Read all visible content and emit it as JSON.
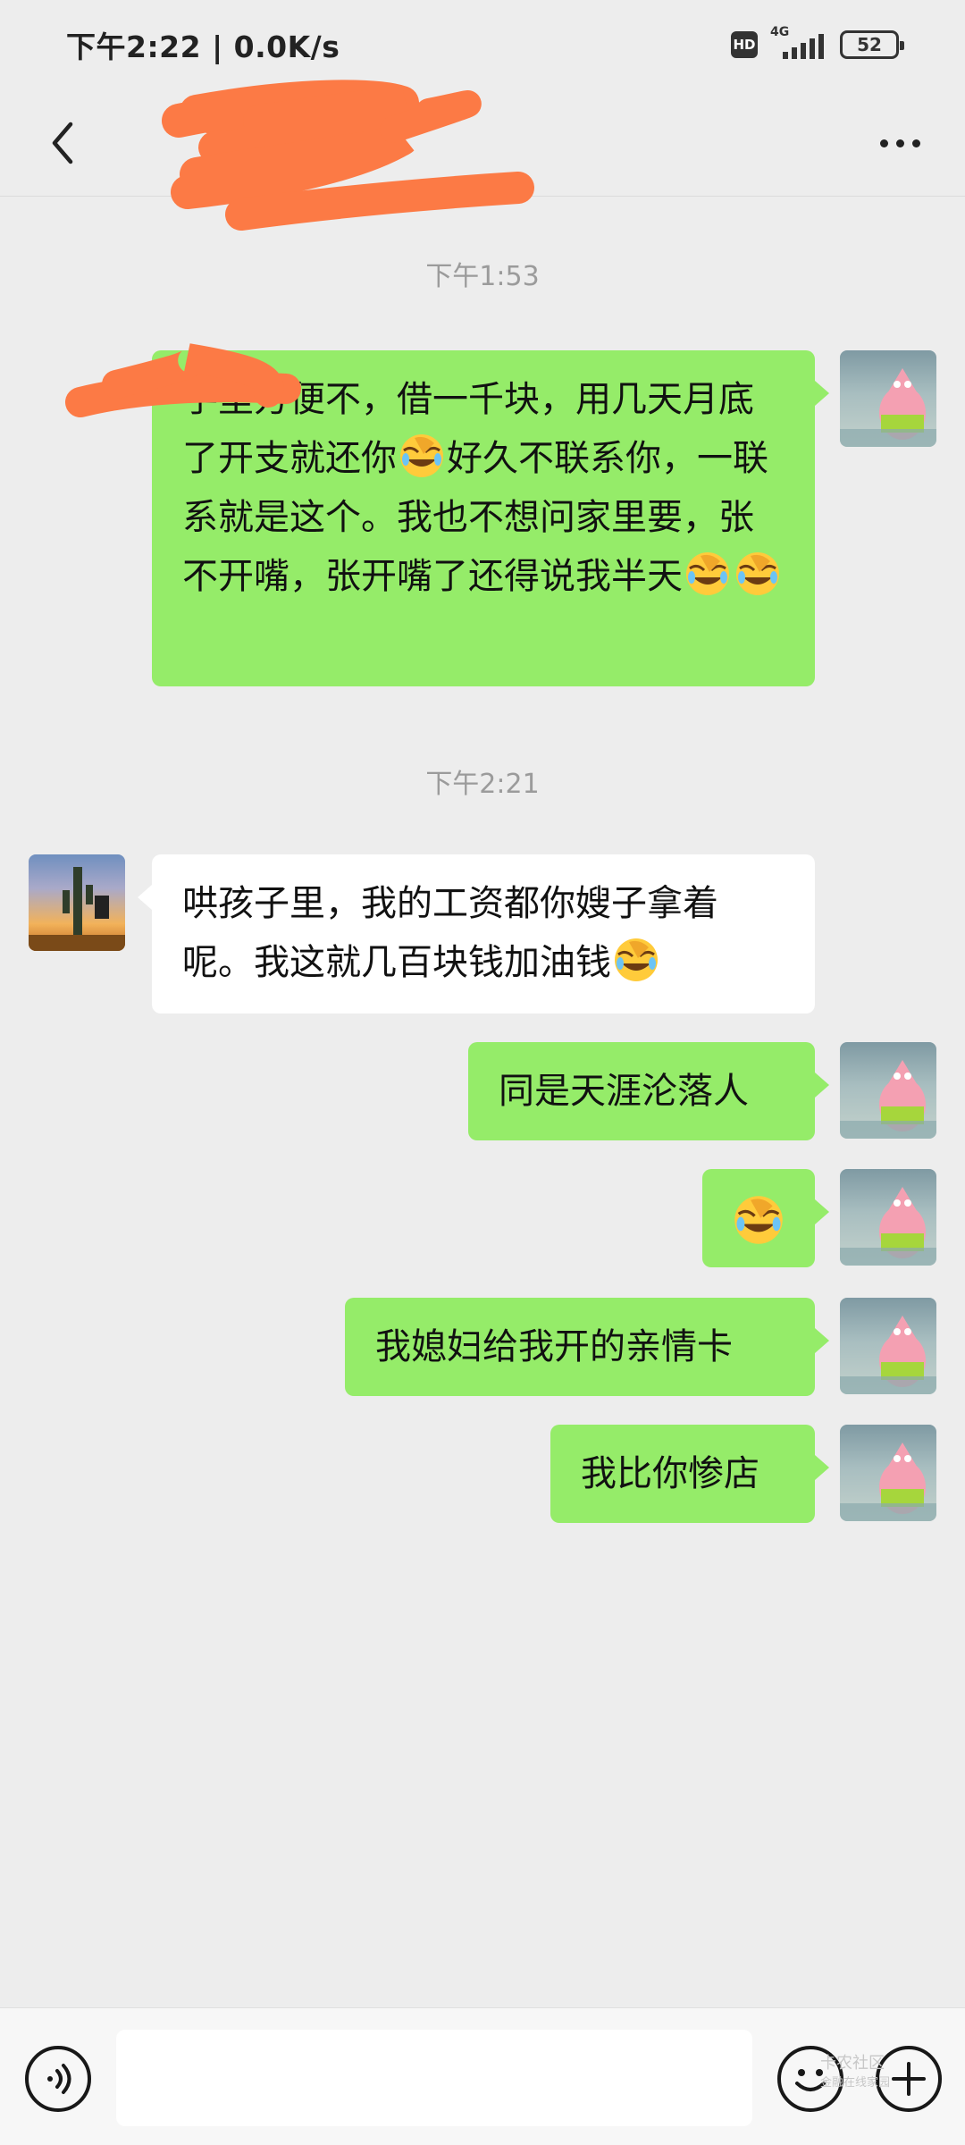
{
  "status_bar": {
    "time_speed": "下午2:22 | 0.0K/s",
    "hd": "HD",
    "network": "4G",
    "battery": "52"
  },
  "header": {
    "title": ""
  },
  "timestamps": [
    "下午1:53",
    "下午2:21"
  ],
  "messages": [
    {
      "side": "right",
      "segments": [
        "手里方便不，借一千块，用几天月底了开支就还你",
        "[emoji]",
        "好久不联系你，一联系就是这个。我也不想问家里要，张不开嘴，张开嘴了还得说我半天",
        "[emoji]",
        "[emoji]"
      ],
      "emoji": "facepalm-laugh-emoji"
    },
    {
      "side": "left",
      "text": "哄孩子里，我的工资都你嫂子拿着呢。我这就几百块钱加油钱",
      "emoji": "facepalm-laugh-emoji"
    },
    {
      "side": "right",
      "text": "同是天涯沦落人"
    },
    {
      "side": "right",
      "text": "",
      "emoji": "facepalm-laugh-emoji"
    },
    {
      "side": "right",
      "text": "我媳妇给我开的亲情卡"
    },
    {
      "side": "right",
      "text": "我比你惨店"
    }
  ],
  "input_bar": {
    "value": "",
    "watermark_line1": "卡农社区",
    "watermark_line2": "金融在线家园"
  },
  "colors": {
    "background": "#ededed",
    "sent_bubble": "#95ec69",
    "received_bubble": "#ffffff",
    "timestamp": "#9b9b9b",
    "redaction": "#fc7a45"
  }
}
